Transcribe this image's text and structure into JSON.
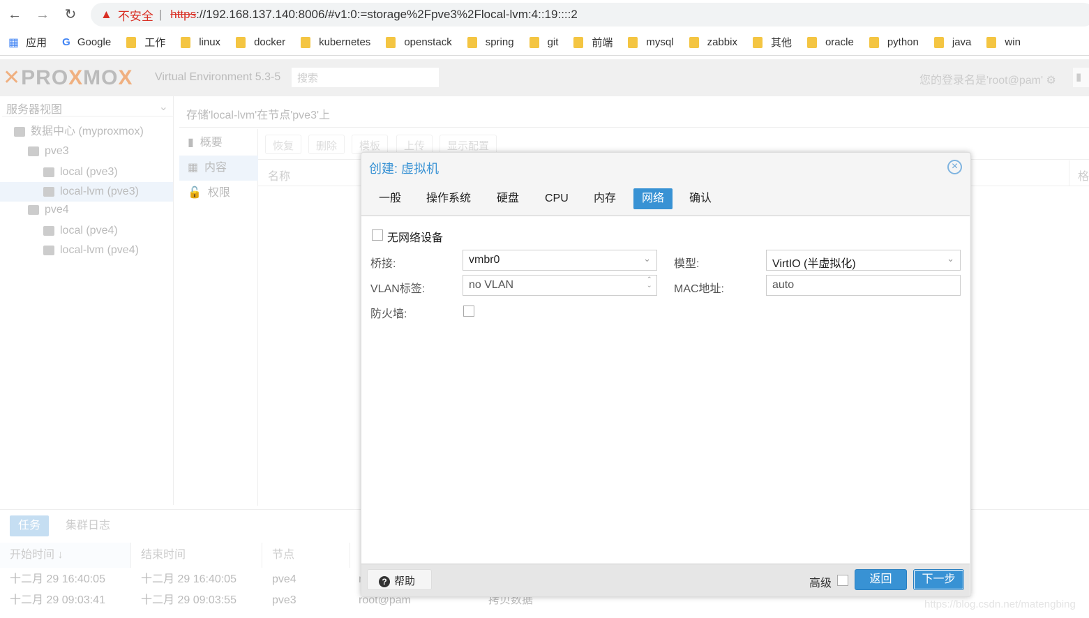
{
  "browser": {
    "back_icon": "arrow-left",
    "forward_icon": "arrow-right",
    "reload_icon": "reload",
    "security_label": "不安全",
    "url_scheme": "https",
    "url_rest": "://192.168.137.140:8006/#v1:0:=storage%2Fpve3%2Flocal-lvm:4::19::::2",
    "bookmarks": [
      "应用",
      "Google",
      "工作",
      "linux",
      "docker",
      "kubernetes",
      "openstack",
      "spring",
      "git",
      "前端",
      "mysql",
      "zabbix",
      "其他",
      "oracle",
      "python",
      "java",
      "win"
    ]
  },
  "header": {
    "logo": "PROXMOX",
    "version": "Virtual Environment 5.3-5",
    "search_placeholder": "搜索",
    "login": "您的登录名是'root@pam'"
  },
  "tree": {
    "view": "服务器视图",
    "items": [
      {
        "label": "数据中心 (myproxmox)"
      },
      {
        "label": "pve3"
      },
      {
        "label": "local (pve3)"
      },
      {
        "label": "local-lvm (pve3)",
        "selected": true
      },
      {
        "label": "pve4"
      },
      {
        "label": "local (pve4)"
      },
      {
        "label": "local-lvm (pve4)"
      }
    ]
  },
  "content": {
    "title": "存储'local-lvm'在节点'pve3'上",
    "nav": [
      "概要",
      "内容",
      "权限"
    ],
    "toolbar": [
      "恢复",
      "删除",
      "模板",
      "上传",
      "显示配置"
    ],
    "col_name": "名称",
    "col_format": "格"
  },
  "bottom": {
    "tabs": [
      "任务",
      "集群日志"
    ],
    "columns": [
      "开始时间 ↓",
      "结束时间",
      "节点"
    ],
    "rows": [
      [
        "十二月 29 16:40:05",
        "十二月 29 16:40:05",
        "pve4",
        "r",
        ""
      ],
      [
        "十二月 29 09:03:41",
        "十二月 29 09:03:55",
        "pve3",
        "root@pam",
        "拷贝数据"
      ]
    ]
  },
  "dialog": {
    "title": "创建: 虚拟机",
    "tabs": [
      "一般",
      "操作系统",
      "硬盘",
      "CPU",
      "内存",
      "网络",
      "确认"
    ],
    "active_tab": "网络",
    "no_network_label": "无网络设备",
    "no_network_checked": false,
    "bridge_label": "桥接:",
    "bridge_value": "vmbr0",
    "vlan_label": "VLAN标签:",
    "vlan_value": "no VLAN",
    "firewall_label": "防火墙:",
    "firewall_checked": false,
    "model_label": "模型:",
    "model_value": "VirtIO (半虚拟化)",
    "mac_label": "MAC地址:",
    "mac_value": "auto",
    "help": "帮助",
    "advanced": "高级",
    "back": "返回",
    "next": "下一步"
  },
  "watermark": "https://blog.csdn.net/matengbing",
  "colors": {
    "accent": "#3892d4",
    "warning": "#d93025"
  }
}
